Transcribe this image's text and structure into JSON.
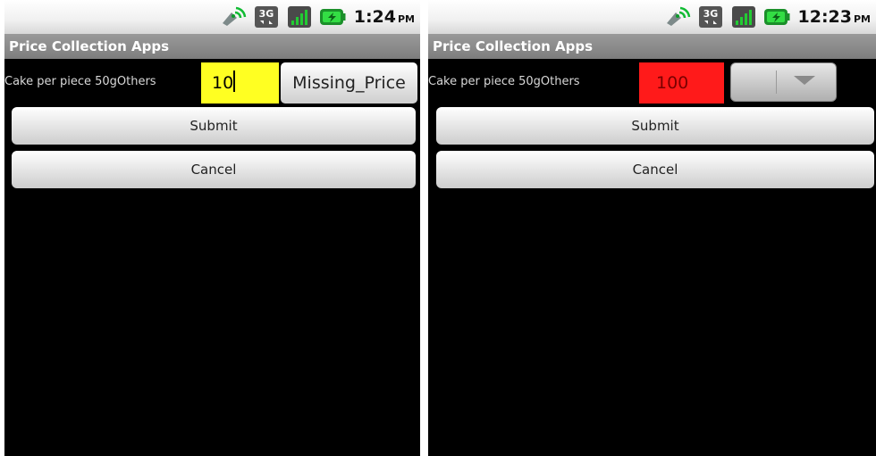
{
  "screens": [
    {
      "status": {
        "time": "1:24",
        "ampm": "PM"
      },
      "app_title": "Price Collection Apps",
      "item_label": "Cake per piece 50gOthers",
      "price_value": "10",
      "price_bg_color": "#ffff22",
      "missing_button_label": "Missing_Price",
      "submit_label": "Submit",
      "cancel_label": "Cancel"
    },
    {
      "status": {
        "time": "12:23",
        "ampm": "PM"
      },
      "app_title": "Price Collection Apps",
      "item_label": "Cake per piece 50gOthers",
      "price_value": "100",
      "price_bg_color": "#ff1a1a",
      "submit_label": "Submit",
      "cancel_label": "Cancel"
    }
  ],
  "icons": [
    "gps-icon",
    "3g-icon",
    "signal-icon",
    "battery-charging-icon"
  ]
}
